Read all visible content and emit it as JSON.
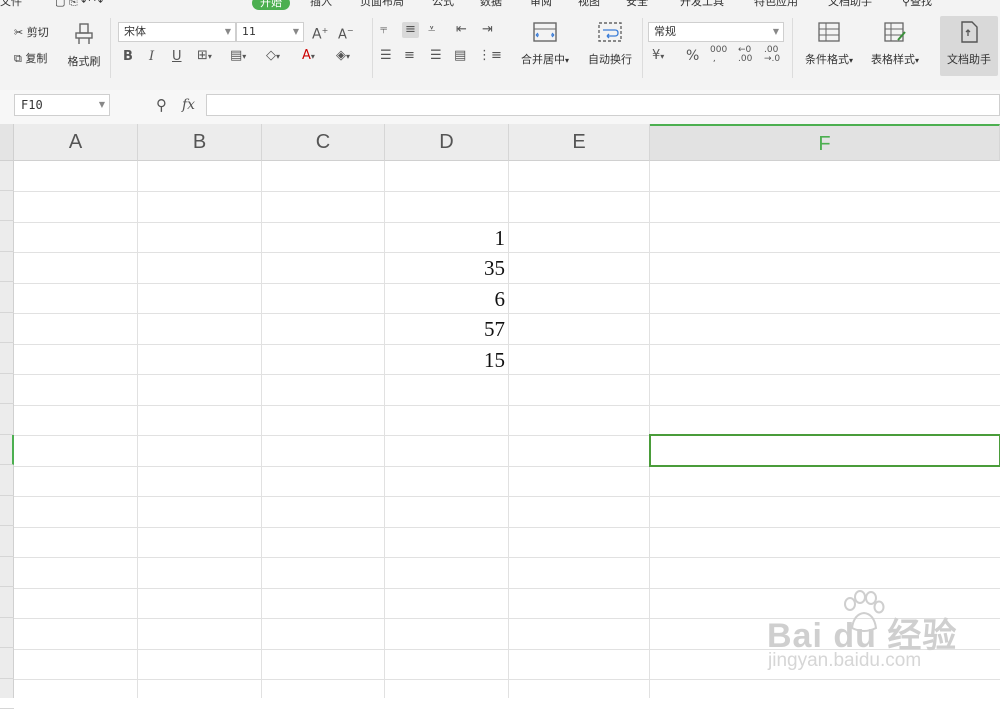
{
  "menu": {
    "items": [
      "文件",
      "开始",
      "插入",
      "页面布局",
      "公式",
      "数据",
      "审阅",
      "视图",
      "安全",
      "开发工具",
      "特色应用",
      "文档助手",
      "查找"
    ],
    "active": "开始"
  },
  "ribbon": {
    "cut_label": "剪切",
    "copy_label": "复制",
    "format_painter_label": "格式刷",
    "font_name": "宋体",
    "font_size": "11",
    "bold": "B",
    "italic": "I",
    "underline": "U",
    "merge_center_label": "合并居中",
    "wrap_text_label": "自动换行",
    "number_format": "常规",
    "percent": "%",
    "thousands": "000",
    "conditional_format_label": "条件格式",
    "table_style_label": "表格样式",
    "doc_assistant_label": "文档助手"
  },
  "formula_bar": {
    "cell_ref": "F10",
    "fx_label": "fx",
    "value": ""
  },
  "grid": {
    "columns": [
      "A",
      "B",
      "C",
      "D",
      "E",
      "F"
    ],
    "active_column": "F",
    "active_cell": "F10",
    "accent_color": "#4caf50",
    "d_values": [
      "1",
      "35",
      "6",
      "57",
      "15"
    ]
  },
  "watermark": {
    "brand": "Bai du 经验",
    "url": "jingyan.baidu.com"
  }
}
